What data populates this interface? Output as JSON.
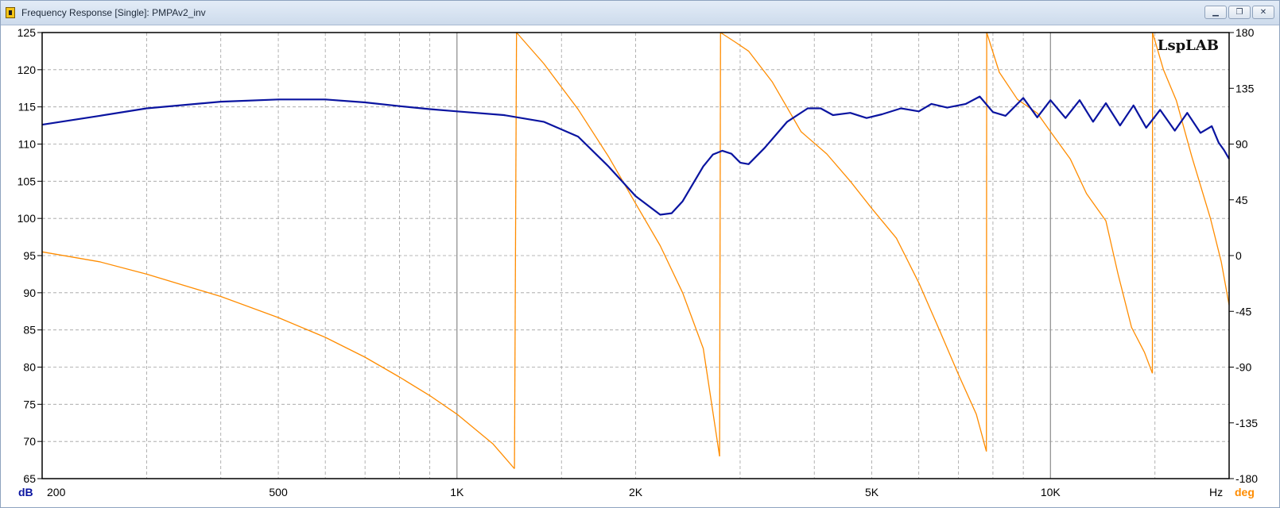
{
  "window": {
    "title": "Frequency Response [Single]: PMPAv2_inv",
    "buttons": [
      "minimize",
      "maximize",
      "close"
    ]
  },
  "brand": "LspLAB",
  "colors": {
    "magnitude": "#0a14a0",
    "phase": "#ff8c00",
    "grid_major": "#8a8a8a",
    "grid_minor": "#a0a0a0"
  },
  "chart_data": {
    "type": "line",
    "x_scale": "log",
    "xlim": [
      200,
      20000
    ],
    "x_tick_labels": [
      {
        "value": 200,
        "label": "200"
      },
      {
        "value": 500,
        "label": "500"
      },
      {
        "value": 1000,
        "label": "1K"
      },
      {
        "value": 2000,
        "label": "2K"
      },
      {
        "value": 5000,
        "label": "5K"
      },
      {
        "value": 10000,
        "label": "10K"
      }
    ],
    "x_unit": "Hz",
    "left_axis": {
      "unit": "dB",
      "ylim": [
        65,
        125
      ],
      "ticks": [
        65,
        70,
        75,
        80,
        85,
        90,
        95,
        100,
        105,
        110,
        115,
        120,
        125
      ]
    },
    "right_axis": {
      "unit": "deg",
      "ylim": [
        -180,
        180
      ],
      "ticks": [
        -180,
        -135,
        -90,
        -45,
        0,
        45,
        90,
        135,
        180
      ]
    },
    "grid": true,
    "series": [
      {
        "axis": "left",
        "points": [
          [
            200,
            112.6
          ],
          [
            250,
            113.8
          ],
          [
            300,
            114.8
          ],
          [
            400,
            115.7
          ],
          [
            500,
            116.0
          ],
          [
            600,
            116.0
          ],
          [
            700,
            115.6
          ],
          [
            800,
            115.1
          ],
          [
            900,
            114.7
          ],
          [
            1000,
            114.4
          ],
          [
            1200,
            113.9
          ],
          [
            1400,
            113.0
          ],
          [
            1600,
            111.0
          ],
          [
            1800,
            107.0
          ],
          [
            2000,
            103.0
          ],
          [
            2200,
            100.5
          ],
          [
            2300,
            100.7
          ],
          [
            2400,
            102.3
          ],
          [
            2600,
            107.0
          ],
          [
            2700,
            108.6
          ],
          [
            2800,
            109.1
          ],
          [
            2900,
            108.7
          ],
          [
            3000,
            107.5
          ],
          [
            3100,
            107.3
          ],
          [
            3300,
            109.5
          ],
          [
            3600,
            113.0
          ],
          [
            3900,
            114.8
          ],
          [
            4100,
            114.8
          ],
          [
            4300,
            113.9
          ],
          [
            4600,
            114.2
          ],
          [
            4900,
            113.5
          ],
          [
            5200,
            114.0
          ],
          [
            5600,
            114.8
          ],
          [
            6000,
            114.4
          ],
          [
            6300,
            115.4
          ],
          [
            6700,
            114.9
          ],
          [
            7200,
            115.4
          ],
          [
            7600,
            116.4
          ],
          [
            8000,
            114.3
          ],
          [
            8400,
            113.8
          ],
          [
            9000,
            116.2
          ],
          [
            9500,
            113.6
          ],
          [
            10000,
            115.9
          ],
          [
            10600,
            113.5
          ],
          [
            11200,
            115.9
          ],
          [
            11800,
            113.0
          ],
          [
            12400,
            115.5
          ],
          [
            13100,
            112.5
          ],
          [
            13800,
            115.2
          ],
          [
            14500,
            112.2
          ],
          [
            15300,
            114.6
          ],
          [
            16200,
            111.8
          ],
          [
            17000,
            114.2
          ],
          [
            17900,
            111.5
          ],
          [
            18700,
            112.4
          ],
          [
            19200,
            110.2
          ],
          [
            19600,
            109.2
          ],
          [
            20000,
            108.0
          ]
        ]
      },
      {
        "axis": "right",
        "segments": [
          [
            [
              200,
              3
            ],
            [
              250,
              -5
            ],
            [
              300,
              -15
            ],
            [
              400,
              -33
            ],
            [
              500,
              -50
            ],
            [
              600,
              -66
            ],
            [
              700,
              -82
            ],
            [
              800,
              -98
            ],
            [
              900,
              -113
            ],
            [
              1000,
              -128
            ],
            [
              1150,
              -152
            ],
            [
              1250,
              -172
            ]
          ],
          [
            [
              1260,
              180
            ],
            [
              1400,
              155
            ],
            [
              1600,
              118
            ],
            [
              1800,
              80
            ],
            [
              2000,
              42
            ],
            [
              2200,
              8
            ],
            [
              2400,
              -30
            ],
            [
              2600,
              -75
            ],
            [
              2770,
              -162
            ]
          ],
          [
            [
              2780,
              180
            ],
            [
              2950,
              172
            ],
            [
              3100,
              165
            ],
            [
              3400,
              140
            ],
            [
              3800,
              100
            ],
            [
              4200,
              82
            ],
            [
              4600,
              60
            ],
            [
              5000,
              38
            ],
            [
              5500,
              14
            ],
            [
              6000,
              -22
            ],
            [
              6500,
              -60
            ],
            [
              7000,
              -96
            ],
            [
              7500,
              -128
            ],
            [
              7800,
              -158
            ]
          ],
          [
            [
              7810,
              180
            ],
            [
              8200,
              148
            ],
            [
              8800,
              126
            ],
            [
              9500,
              115
            ],
            [
              10000,
              100
            ],
            [
              10800,
              78
            ],
            [
              11500,
              50
            ],
            [
              12400,
              28
            ],
            [
              13000,
              -15
            ],
            [
              13700,
              -58
            ],
            [
              14400,
              -78
            ],
            [
              14850,
              -95
            ]
          ],
          [
            [
              14860,
              180
            ],
            [
              15500,
              150
            ],
            [
              16300,
              125
            ],
            [
              17300,
              80
            ],
            [
              18600,
              30
            ],
            [
              19400,
              -5
            ],
            [
              20000,
              -40
            ]
          ]
        ]
      }
    ]
  }
}
